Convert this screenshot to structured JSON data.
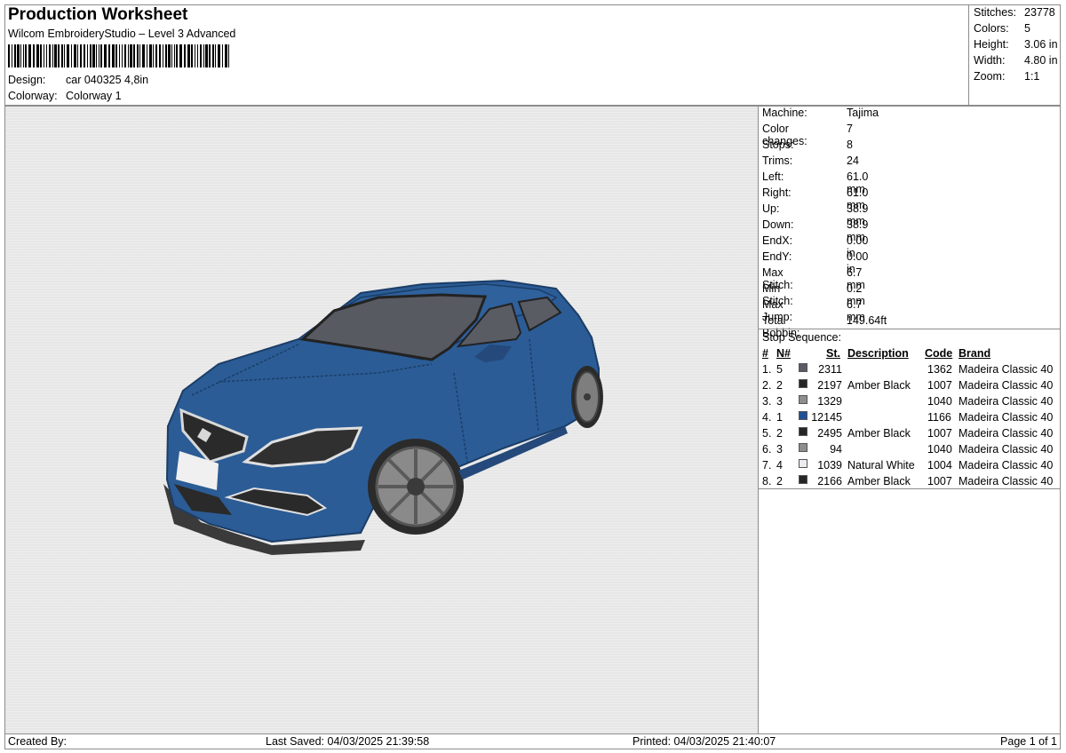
{
  "header": {
    "title": "Production Worksheet",
    "subtitle": "Wilcom EmbroideryStudio – Level 3 Advanced",
    "design_label": "Design:",
    "design_value": "car 040325 4,8in",
    "colorway_label": "Colorway:",
    "colorway_value": "Colorway 1"
  },
  "summary": [
    {
      "label": "Stitches:",
      "value": "23778"
    },
    {
      "label": "Colors:",
      "value": "5"
    },
    {
      "label": "Height:",
      "value": "3.06 in"
    },
    {
      "label": "Width:",
      "value": "4.80 in"
    },
    {
      "label": "Zoom:",
      "value": "1:1"
    }
  ],
  "stats": [
    {
      "label": "Machine:",
      "value": "Tajima"
    },
    {
      "label": "Color changes:",
      "value": "7"
    },
    {
      "label": "Stops:",
      "value": "8"
    },
    {
      "label": "Trims:",
      "value": "24"
    },
    {
      "label": "Left:",
      "value": "61.0 mm"
    },
    {
      "label": "Right:",
      "value": "61.0 mm"
    },
    {
      "label": "Up:",
      "value": "38.9 mm"
    },
    {
      "label": "Down:",
      "value": "38.9 mm"
    },
    {
      "label": "EndX:",
      "value": "0.00 in"
    },
    {
      "label": "EndY:",
      "value": "0.00 in"
    },
    {
      "label": "Max Stitch:",
      "value": "6.7 mm"
    },
    {
      "label": "Min Stitch:",
      "value": "0.2 mm"
    },
    {
      "label": "Max Jump:",
      "value": "6.7 mm"
    },
    {
      "label": "Total Bobbin:",
      "value": "149.64ft"
    }
  ],
  "stop_sequence": {
    "label": "Stop Sequence:",
    "headers": {
      "stop": "#",
      "needle": "N#",
      "stitches": "St.",
      "description": "Description",
      "code": "Code",
      "brand": "Brand"
    },
    "rows": [
      {
        "stop": "1.",
        "needle": "5",
        "color": "#5c5a66",
        "stitches": "2311",
        "description": "",
        "code": "1362",
        "brand": "Madeira Classic 40"
      },
      {
        "stop": "2.",
        "needle": "2",
        "color": "#262626",
        "stitches": "2197",
        "description": "Amber Black",
        "code": "1007",
        "brand": "Madeira Classic 40"
      },
      {
        "stop": "3.",
        "needle": "3",
        "color": "#8e8e8e",
        "stitches": "1329",
        "description": "",
        "code": "1040",
        "brand": "Madeira Classic 40"
      },
      {
        "stop": "4.",
        "needle": "1",
        "color": "#1f4f94",
        "stitches": "12145",
        "description": "",
        "code": "1166",
        "brand": "Madeira Classic 40"
      },
      {
        "stop": "5.",
        "needle": "2",
        "color": "#262626",
        "stitches": "2495",
        "description": "Amber Black",
        "code": "1007",
        "brand": "Madeira Classic 40"
      },
      {
        "stop": "6.",
        "needle": "3",
        "color": "#8e8e8e",
        "stitches": "94",
        "description": "",
        "code": "1040",
        "brand": "Madeira Classic 40"
      },
      {
        "stop": "7.",
        "needle": "4",
        "color": "#ececf0",
        "stitches": "1039",
        "description": "Natural White",
        "code": "1004",
        "brand": "Madeira Classic 40"
      },
      {
        "stop": "8.",
        "needle": "2",
        "color": "#262626",
        "stitches": "2166",
        "description": "Amber Black",
        "code": "1007",
        "brand": "Madeira Classic 40"
      }
    ]
  },
  "footer": {
    "created_by": "Created By:",
    "last_saved": "Last Saved: 04/03/2025 21:39:58",
    "printed": "Printed: 04/03/2025 21:40:07",
    "page": "Page 1 of 1"
  }
}
